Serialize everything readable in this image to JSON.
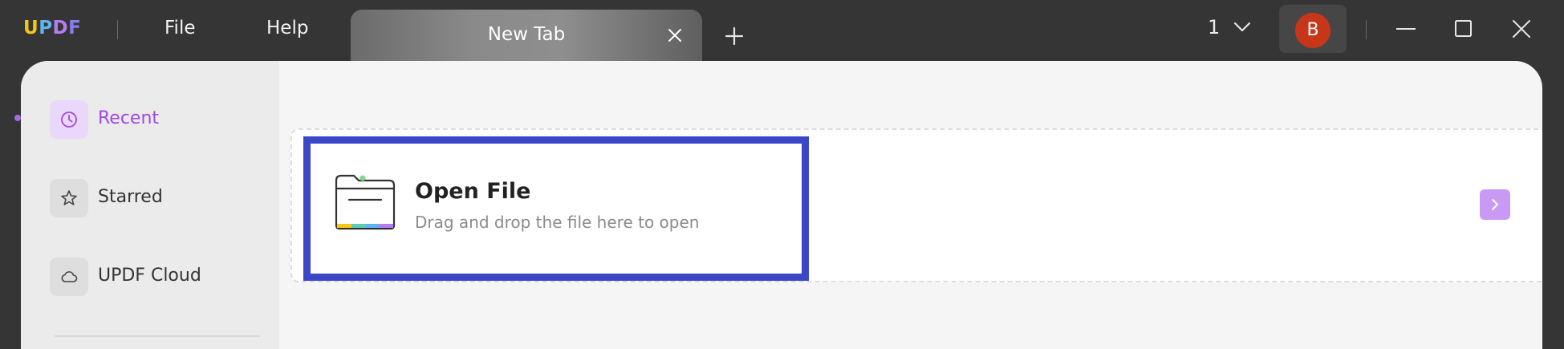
{
  "app": {
    "logo_letters": [
      "U",
      "P",
      "D",
      "F"
    ],
    "logo_colors": [
      "#f5c518",
      "#5fb3f0",
      "#b57cf0",
      "#8a7bf0"
    ]
  },
  "menu": {
    "file": "File",
    "help": "Help"
  },
  "tab": {
    "title": "New Tab",
    "close_icon": "close-icon",
    "new_tab_icon": "plus-icon"
  },
  "titlebar": {
    "page_count": "1",
    "avatar_letter": "B",
    "avatar_color": "#c8361a",
    "window_controls": [
      "minimize-icon",
      "maximize-icon",
      "close-icon"
    ]
  },
  "sidebar": {
    "items": [
      {
        "label": "Recent",
        "icon": "clock-icon",
        "active": true
      },
      {
        "label": "Starred",
        "icon": "star-icon",
        "active": false
      },
      {
        "label": "UPDF Cloud",
        "icon": "cloud-icon",
        "active": false
      }
    ],
    "accent_color": "#a048e8"
  },
  "main": {
    "open_file": {
      "title": "Open File",
      "subtitle": "Drag and drop the file here to open",
      "icon": "folder-icon",
      "highlight_color": "#3c46c8"
    },
    "next_icon": "chevron-right-icon"
  }
}
